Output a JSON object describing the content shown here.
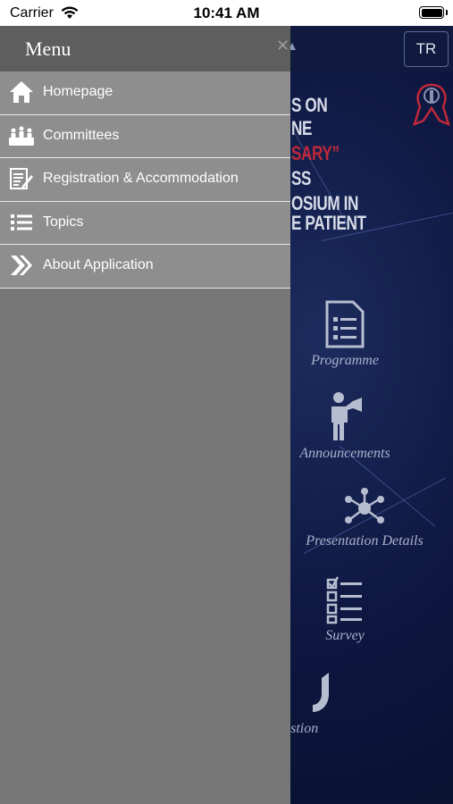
{
  "status_bar": {
    "carrier": "Carrier",
    "time": "10:41 AM",
    "wifi_icon": "wifi-icon",
    "battery_icon": "battery-icon"
  },
  "drawer": {
    "title": "Menu",
    "close_icon": "close-icon",
    "items": [
      {
        "label": "Homepage",
        "icon": "home-icon"
      },
      {
        "label": "Committees",
        "icon": "committees-icon"
      },
      {
        "label": "Registration & Accommodation",
        "icon": "registration-icon"
      },
      {
        "label": "Topics",
        "icon": "list-icon"
      },
      {
        "label": "About Application",
        "icon": "chevrons-right-icon"
      }
    ]
  },
  "background_app": {
    "language_button": "TR",
    "banner_lines": [
      "S ON",
      "NE",
      "SARY”",
      "SS",
      "OSIUM IN",
      "E PATIENT"
    ],
    "features": [
      {
        "label": "Programme",
        "icon": "document-list-icon"
      },
      {
        "label": "Announcements",
        "icon": "megaphone-person-icon"
      },
      {
        "label": "Presentation Details",
        "icon": "network-icon"
      },
      {
        "label": "Survey",
        "icon": "checklist-icon"
      },
      {
        "label": "estion",
        "icon": "hand-raise-icon"
      }
    ]
  },
  "colors": {
    "drawer_bg": "#777777",
    "drawer_header": "#5e5e5e",
    "menu_item_bg": "#8e8e8e",
    "menu_divider": "#e9e9e9",
    "app_bg": "#0d1740",
    "accent_red": "#c0283a"
  }
}
